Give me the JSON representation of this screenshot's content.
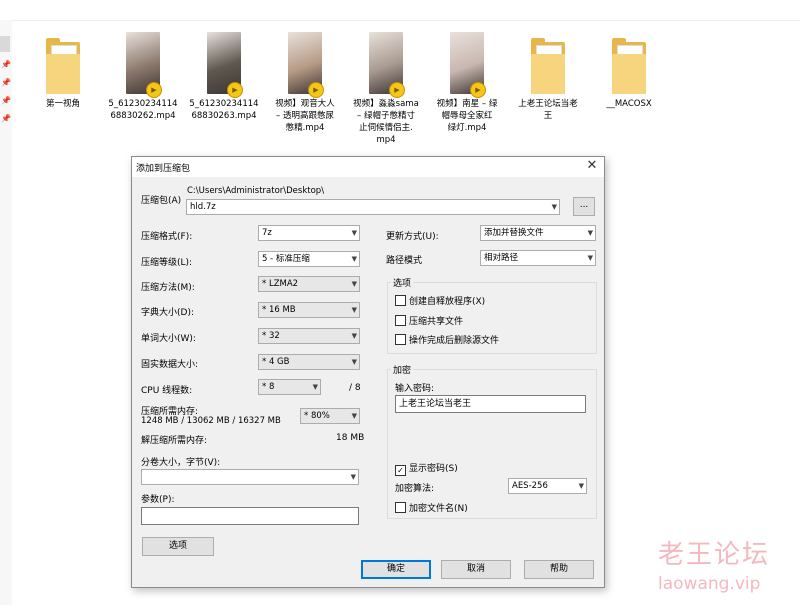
{
  "files": [
    {
      "name": "第一视角",
      "type": "folder"
    },
    {
      "name": "5_6123023411468830262.mp4",
      "line1": "5_61230234114",
      "line2": "68830262.mp4",
      "type": "video",
      "thumb_color": "#8d7a6e"
    },
    {
      "name": "5_6123023411468830263.mp4",
      "line1": "5_61230234114",
      "line2": "68830263.mp4",
      "type": "video",
      "thumb_color": "#5f5850"
    },
    {
      "name": "视频】观音大人 – 透明高跟憋尿憋精.mp4",
      "line1": "视频】观音大人",
      "line2": "– 透明高跟憋尿",
      "line3": "憋精.mp4",
      "type": "video",
      "thumb_color": "#b79b86"
    },
    {
      "name": "视频】淼淼sama – 绿帽子憋精寸止伺候情侣主.mp4",
      "line1": "视频】淼淼sama",
      "line2": "– 绿帽子憋精寸",
      "line3": "止伺候情侣主.",
      "line4": "mp4",
      "type": "video",
      "thumb_color": "#a89a90"
    },
    {
      "name": "视频】南星 – 绿帽辱母全家红绿灯.mp4",
      "line1": "视频】南星 – 绿",
      "line2": "帽辱母全家红",
      "line3": "绿灯.mp4",
      "type": "video",
      "thumb_color": "#c9b7b0"
    },
    {
      "name": "上老王论坛当老王",
      "line1": "上老王论坛当老",
      "line2": "王",
      "type": "folder"
    },
    {
      "name": "__MACOSX",
      "type": "folder"
    }
  ],
  "dialog": {
    "title": "添加到压缩包",
    "archive_label": "压缩包(A)",
    "archive_path": "C:\\Users\\Administrator\\Desktop\\",
    "archive_name": "hld.7z",
    "browse_label": "...",
    "format_label": "压缩格式(F):",
    "format_value": "7z",
    "level_label": "压缩等级(L):",
    "level_value": "5 - 标准压缩",
    "method_label": "压缩方法(M):",
    "method_value": "* LZMA2",
    "dict_label": "字典大小(D):",
    "dict_value": "* 16 MB",
    "word_label": "单词大小(W):",
    "word_value": "* 32",
    "solid_label": "固实数据大小:",
    "solid_value": "* 4 GB",
    "cpu_label": "CPU 线程数:",
    "cpu_value": "* 8",
    "cpu_total": "/ 8",
    "mem_label": "压缩所需内存:",
    "mem_value": "1248 MB / 13062 MB / 16327 MB",
    "mem_percent": "* 80%",
    "decomp_label": "解压缩所需内存:",
    "decomp_value": "18 MB",
    "split_label": "分卷大小，字节(V):",
    "split_value": "",
    "params_label": "参数(P):",
    "params_value": "",
    "options_button": "选项",
    "update_label": "更新方式(U):",
    "update_value": "添加并替换文件",
    "path_label": "路径模式",
    "path_value": "相对路径",
    "options_group": "选项",
    "opt_sfx": "创建自释放程序(X)",
    "opt_shared": "压缩共享文件",
    "opt_delete": "操作完成后删除源文件",
    "enc_group": "加密",
    "password_label": "输入密码:",
    "password_value": "上老王论坛当老王",
    "show_password": "显示密码(S)",
    "enc_method_label": "加密算法:",
    "enc_method_value": "AES-256",
    "enc_names": "加密文件名(N)",
    "ok": "确定",
    "cancel": "取消",
    "help": "帮助"
  },
  "watermark": {
    "cn": "老王论坛",
    "en": "laowang.vip"
  }
}
